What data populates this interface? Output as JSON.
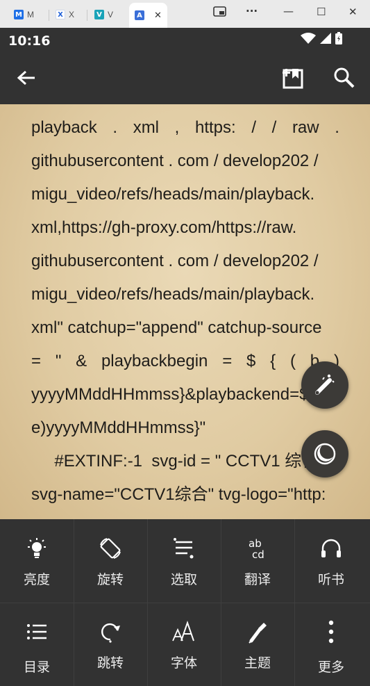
{
  "browser": {
    "tabs": [
      {
        "label": "M",
        "icon": "app-m-icon",
        "color": "#1e6fe6",
        "glyph": "M"
      },
      {
        "label": "X",
        "icon": "app-x-icon",
        "color": "#ffffff",
        "glyph": "X"
      },
      {
        "label": "V",
        "icon": "app-v-icon",
        "color": "#1aa3b8",
        "glyph": "V"
      },
      {
        "label": "A",
        "icon": "app-a-icon",
        "color": "#3a6fd8",
        "glyph": "A"
      }
    ],
    "close_glyph": "✕",
    "window_controls": {
      "more": "···",
      "minimize": "—",
      "maximize": "☐",
      "close": "✕"
    }
  },
  "status_bar": {
    "time": "10:16"
  },
  "reader": {
    "lines": [
      {
        "parts": [
          "playback",
          ".",
          "xml",
          ",",
          "https:",
          "/",
          "/",
          "raw",
          "."
        ]
      },
      {
        "text": "githubusercontent . com / develop202 /"
      },
      {
        "text": "migu_video/refs/heads/main/playback."
      },
      {
        "text": "xml,https://gh-proxy.com/https://raw."
      },
      {
        "text": "githubusercontent . com / develop202 /"
      },
      {
        "text": "migu_video/refs/heads/main/playback."
      },
      {
        "text": "xml\" catchup=\"append\" catchup-source"
      },
      {
        "parts": [
          "=",
          "\"",
          "&",
          "playbackbegin",
          "=",
          "$",
          "{",
          "(",
          "b",
          ")"
        ]
      },
      {
        "text": "yyyyMMddHHmmss}&playbackend=${("
      },
      {
        "text": "e)yyyyMMddHHmmss}\""
      },
      {
        "text": "     #EXTINF:-1  svg-id = \" CCTV1 综合"
      },
      {
        "text": "svg-name=\"CCTV1综合\" tvg-logo=\"http:"
      }
    ]
  },
  "menu": {
    "row1": [
      {
        "label": "亮度",
        "icon": "brightness-icon"
      },
      {
        "label": "旋转",
        "icon": "rotate-icon"
      },
      {
        "label": "选取",
        "icon": "select-icon"
      },
      {
        "label": "翻译",
        "icon": "translate-icon"
      },
      {
        "label": "听书",
        "icon": "headphones-icon"
      }
    ],
    "row2": [
      {
        "label": "目录",
        "icon": "toc-icon"
      },
      {
        "label": "跳转",
        "icon": "jump-icon"
      },
      {
        "label": "字体",
        "icon": "font-icon"
      },
      {
        "label": "主题",
        "icon": "theme-icon"
      },
      {
        "label": "更多",
        "icon": "more-icon"
      }
    ]
  },
  "colors": {
    "appbar": "#323232",
    "paper": "#e4cfa8",
    "text": "#1f1d1a",
    "menu_text": "#ececec"
  }
}
